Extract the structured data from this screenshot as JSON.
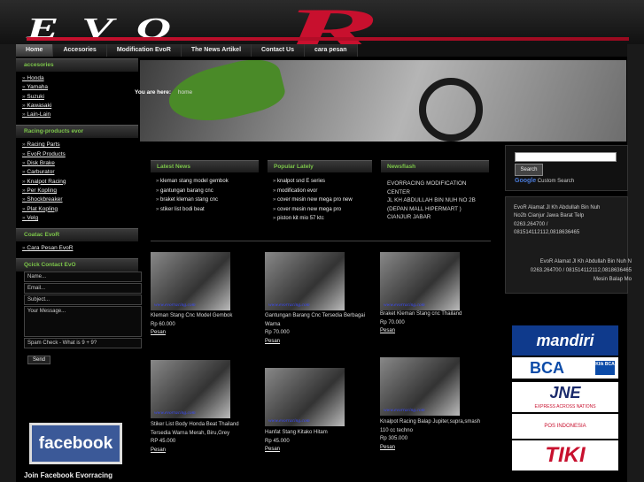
{
  "brand": {
    "logo_evo": "EVO",
    "logo_r": "R"
  },
  "nav": [
    "Home",
    "Accesories",
    "Modification EvoR",
    "The News Artikel",
    "Contact Us",
    "cara pesan"
  ],
  "sidebar": {
    "accesories": {
      "title": "accesories",
      "items": [
        "Honda",
        "Yamaha",
        "Suzuki",
        "Kawasaki",
        "Lain-Lain"
      ]
    },
    "racing": {
      "title": "Racing-products evor",
      "items": [
        "Racing Parts",
        "EvoR Products",
        "Disk Brake",
        "Carburator",
        "Knalpot Racing",
        "Per Kopling",
        "Shockbreaker",
        "Plat Kopling",
        "Velg"
      ]
    },
    "contact": {
      "title": "Coatac EvoR",
      "items": [
        "Cara Pesan EvoR"
      ]
    },
    "quick": {
      "title": "Qcick Contact EvO",
      "name": "Name...",
      "email": "Email...",
      "subject": "Subject...",
      "message": "Your Message...",
      "spam": "Spam Check - What is 9 + 9?",
      "send": "Send"
    },
    "facebook": {
      "logo": "facebook",
      "join": "Join Facebook Evorracing"
    }
  },
  "breadcrumb": {
    "label": "You are here:",
    "page": "home"
  },
  "latest_news": {
    "title": "Latest News",
    "items": [
      "kleman stang model gembok",
      "gantungan barang cnc",
      "braket kleman stang cnc",
      "stiker list bodi beat"
    ]
  },
  "popular": {
    "title": "Popular Lately",
    "items": [
      "knalpot snd E series",
      "modification evor",
      "cover mesin new mega pro new",
      "cover mesin new mega pro",
      "piston kit mio 57 ktc"
    ]
  },
  "newsflash": {
    "title": "Newsflash",
    "lines": [
      "EVORRACING  MODIFICATION",
      "CENTER",
      "JL KH ABDULLAH BIN NUH NO 2B",
      "(DEPAN MALL HIPERMART )",
      "CIANJUR JABAR"
    ]
  },
  "products": [
    {
      "lines": [
        "Kleman Stang Cnc Model Gembok"
      ],
      "price": "Rp 60.000",
      "buy": "Pesan",
      "watermark": "www.evorracing.com"
    },
    {
      "lines": [
        "Gantungan Barang Cnc Tersedia Berbagai",
        "Warna"
      ],
      "price": "Rp 70.000",
      "buy": "Pesan",
      "watermark": "www.evorracing.com"
    },
    {
      "lines": [
        "Braket Kleman Stang cnc Thailand"
      ],
      "price": "Rp 70.000",
      "buy": "Pesan",
      "watermark": "www.evorracing.com"
    },
    {
      "lines": [
        "Stiker List Body Honda Beat Thailand",
        "Tersedia Warna Merah, Biru,Grey"
      ],
      "price": "RP 45.000",
      "buy": "Pesan",
      "watermark": "www.evorracing.com"
    },
    {
      "lines": [
        "Hanfat Stang Kitako Hitam"
      ],
      "price": "Rp 45.000",
      "buy": "Pesan",
      "watermark": "www.evorracing.com"
    },
    {
      "lines": [
        "Knalpot Racing Balap Jupiter,supra,smash",
        "110 cc techno"
      ],
      "price": "Rp 305.000",
      "buy": "Pesan",
      "watermark": "www.evorracing.com"
    }
  ],
  "search": {
    "button": "Search",
    "google": "Google",
    "custom": "Custom Search"
  },
  "address": {
    "block1": [
      "EvoR Alamat Jl Kh Abdullah Bin Nuh",
      "No2b Cianjur Jawa Barat Telp",
      "0263.264700 /",
      "081514112112,0818636465"
    ],
    "block2": [
      "EvoR Alamat Jl Kh Abdullah Bin Nuh N",
      "0263.264700 / 081514112112,0818636465",
      "Mesin Balap Mo"
    ]
  },
  "partners": {
    "mandiri": "mandiri",
    "bca": "BCA",
    "klikbca": "Klik BCA",
    "jne": "JNE",
    "jne_sub": "EXPRESS ACROSS NATIONS",
    "pos": "POS INDONESIA",
    "tiki": "TIKI"
  }
}
